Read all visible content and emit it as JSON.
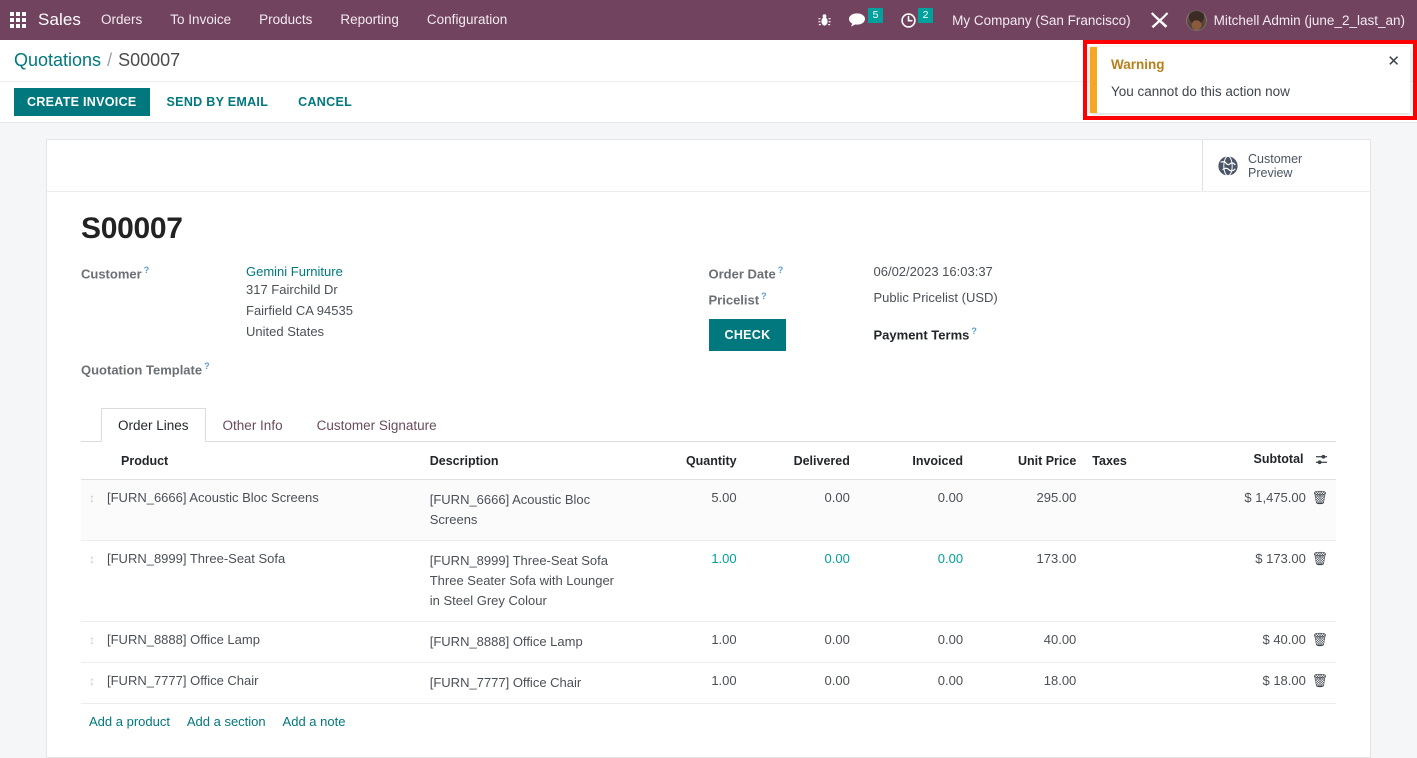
{
  "navbar": {
    "apps_icon": "apps-grid-icon",
    "brand": "Sales",
    "menu": [
      "Orders",
      "To Invoice",
      "Products",
      "Reporting",
      "Configuration"
    ],
    "bug_icon": "bug-icon",
    "messages_icon": "chat-bubble-icon",
    "messages_count": "5",
    "activities_icon": "clock-icon",
    "activities_count": "2",
    "company": "My Company (San Francisco)",
    "tools_icon": "tools-icon",
    "user": "Mitchell Admin (june_2_last_an)",
    "bg_color": "#71435f",
    "badge_color": "#00a09d"
  },
  "breadcrumb": {
    "parent": "Quotations",
    "separator": "/",
    "current": "S00007"
  },
  "actions": {
    "create_invoice": "CREATE INVOICE",
    "send_by_email": "SEND BY EMAIL",
    "cancel": "CANCEL",
    "primary_color": "#00787d"
  },
  "stat_button": {
    "icon": "globe-icon",
    "label": "Customer\nPreview"
  },
  "record": {
    "title": "S00007",
    "left_fields": [
      {
        "label": "Customer",
        "tip": "?",
        "value": "Gemini Furniture",
        "is_link": true
      },
      {
        "label": "Quotation Template",
        "tip": "?",
        "value": "",
        "is_link": false
      }
    ],
    "customer_address": [
      "317 Fairchild Dr",
      "Fairfield CA 94535",
      "United States"
    ],
    "right_fields": [
      {
        "label": "Order Date",
        "tip": "?",
        "value": "06/02/2023 16:03:37"
      },
      {
        "label": "Pricelist",
        "tip": "?",
        "value": "Public Pricelist (USD)"
      }
    ],
    "check_button": "CHECK",
    "payment_terms_label": "Payment Terms",
    "payment_terms_tip": "?"
  },
  "notebook": {
    "tabs": [
      {
        "label": "Order Lines",
        "active": true
      },
      {
        "label": "Other Info",
        "active": false
      },
      {
        "label": "Customer Signature",
        "active": false
      }
    ]
  },
  "order_lines": {
    "columns": [
      "Product",
      "Description",
      "Quantity",
      "Delivered",
      "Invoiced",
      "Unit Price",
      "Taxes",
      "Subtotal"
    ],
    "options_icon": "sliders-icon",
    "rows": [
      {
        "handle": "drag-handle-icon",
        "product": "[FURN_6666] Acoustic Bloc Screens",
        "description": "[FURN_6666] Acoustic Bloc Screens",
        "quantity": "5.00",
        "delivered": "0.00",
        "invoiced": "0.00",
        "unit_price": "295.00",
        "taxes": "",
        "subtotal": "$ 1,475.00",
        "delete_icon": "trash-icon",
        "selected": false
      },
      {
        "handle": "drag-handle-icon",
        "product": "[FURN_8999] Three-Seat Sofa",
        "description": "[FURN_8999] Three-Seat Sofa\nThree Seater Sofa with Lounger in Steel Grey Colour",
        "quantity": "1.00",
        "delivered": "0.00",
        "invoiced": "0.00",
        "unit_price": "173.00",
        "taxes": "",
        "subtotal": "$ 173.00",
        "delete_icon": "trash-icon",
        "selected": true
      },
      {
        "handle": "drag-handle-icon",
        "product": "[FURN_8888] Office Lamp",
        "description": "[FURN_8888] Office Lamp",
        "quantity": "1.00",
        "delivered": "0.00",
        "invoiced": "0.00",
        "unit_price": "40.00",
        "taxes": "",
        "subtotal": "$ 40.00",
        "delete_icon": "trash-icon",
        "selected": false
      },
      {
        "handle": "drag-handle-icon",
        "product": "[FURN_7777] Office Chair",
        "description": "[FURN_7777] Office Chair",
        "quantity": "1.00",
        "delivered": "0.00",
        "invoiced": "0.00",
        "unit_price": "18.00",
        "taxes": "",
        "subtotal": "$ 18.00",
        "delete_icon": "trash-icon",
        "selected": false
      }
    ],
    "add_links": [
      "Add a product",
      "Add a section",
      "Add a note"
    ]
  },
  "notification": {
    "title": "Warning",
    "message": "You cannot do this action now",
    "close_icon": "close-icon",
    "accent_color": "#f5a623",
    "highlight_color": "#ff0000"
  }
}
